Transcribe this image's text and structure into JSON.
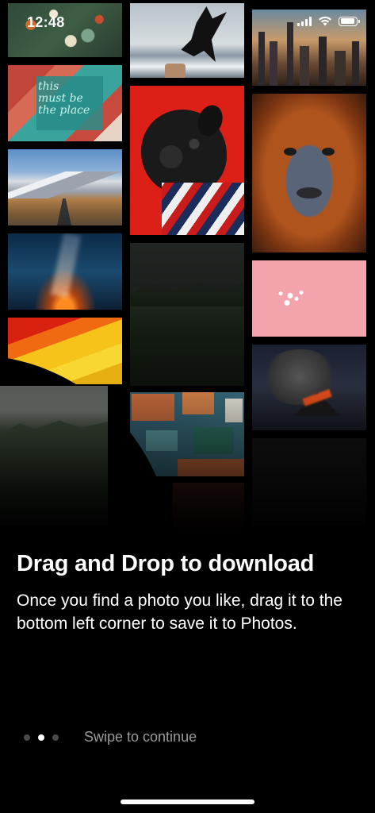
{
  "status_bar": {
    "time": "12:48"
  },
  "photos": [
    {
      "name": "photo-flowers",
      "subject": "flowers"
    },
    {
      "name": "photo-neon-sign",
      "subject": "neon sign",
      "text": "this must be the place"
    },
    {
      "name": "photo-mountain-road",
      "subject": "mountain road"
    },
    {
      "name": "photo-milky-way",
      "subject": "milky way night sky"
    },
    {
      "name": "photo-parrot-feathers",
      "subject": "parrot feathers"
    },
    {
      "name": "photo-eagle",
      "subject": "eagle"
    },
    {
      "name": "photo-pug",
      "subject": "pug"
    },
    {
      "name": "photo-green-hills",
      "subject": "green hills"
    },
    {
      "name": "photo-aerial-city",
      "subject": "aerial city"
    },
    {
      "name": "photo-city-skyline",
      "subject": "city skyline"
    },
    {
      "name": "photo-orangutan",
      "subject": "orangutan"
    },
    {
      "name": "photo-pink-pearls",
      "subject": "pink background with pearls"
    },
    {
      "name": "photo-volcano",
      "subject": "volcano eruption"
    },
    {
      "name": "photo-dragged-hills",
      "subject": "green hills (being dragged)"
    }
  ],
  "onboarding": {
    "title": "Drag and Drop to download",
    "description": "Once you find a photo you like, drag it to the bottom left corner to save it to Photos.",
    "swipe_hint": "Swipe to continue",
    "page_count": 3,
    "current_page": 2
  }
}
